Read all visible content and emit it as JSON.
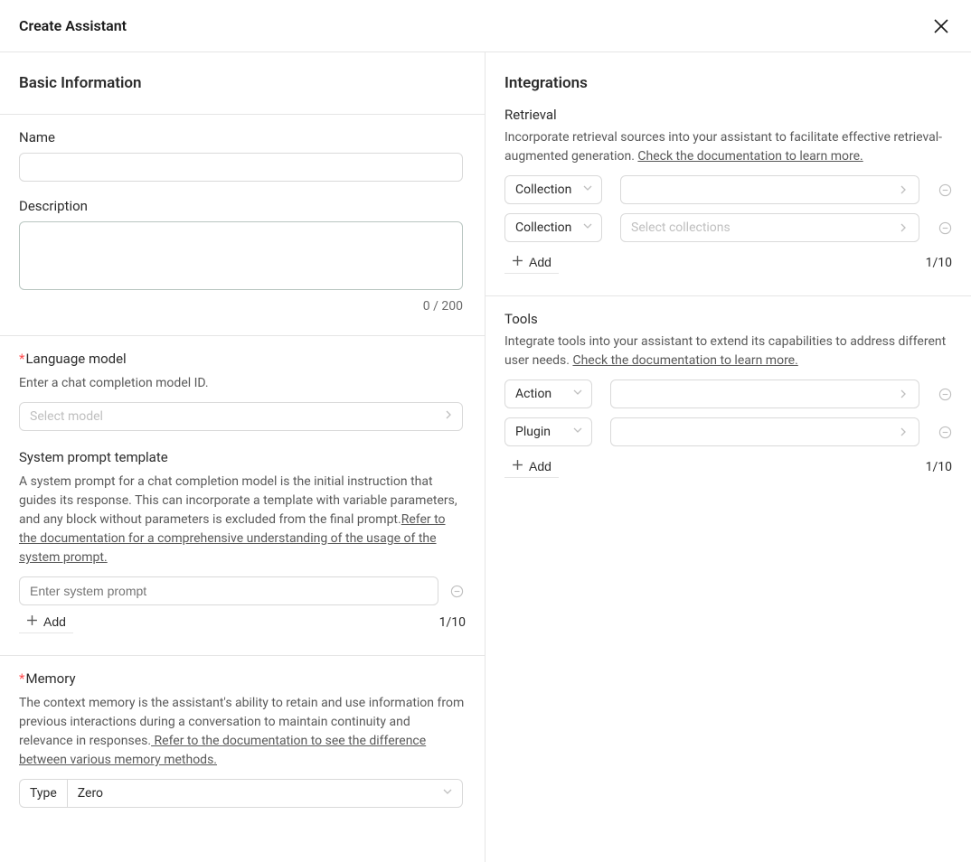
{
  "header": {
    "title": "Create Assistant"
  },
  "left": {
    "section_title": "Basic Information",
    "name": {
      "label": "Name",
      "value": ""
    },
    "description": {
      "label": "Description",
      "value": "",
      "char_count": "0 / 200"
    },
    "language_model": {
      "label": "Language model",
      "description": "Enter a chat completion model ID.",
      "placeholder": "Select model"
    },
    "system_prompt": {
      "label": "System prompt template",
      "description_before_link": "A system prompt for a chat completion model is the initial instruction that guides its response. This can incorporate a template with variable parameters, and any block without parameters is excluded from the final prompt.",
      "doc_link": "Refer to the documentation for a comprehensive understanding of the usage of the system prompt.",
      "placeholder": "Enter system prompt",
      "add_label": "Add",
      "counter": "1/10"
    },
    "memory": {
      "label": "Memory",
      "description_before_link": "The context memory is the assistant's ability to retain and use information from previous interactions during a conversation to maintain continuity and relevance in responses.",
      "doc_link": " Refer to the documentation to see the difference between various memory methods.",
      "type_label": "Type",
      "type_value": "Zero"
    }
  },
  "right": {
    "section_title": "Integrations",
    "retrieval": {
      "label": "Retrieval",
      "description": "Incorporate retrieval sources into your assistant to facilitate effective retrieval-augmented generation. ",
      "doc_link": "Check the documentation to learn more.",
      "rows": [
        {
          "type_label": "Collection",
          "placeholder": ""
        },
        {
          "type_label": "Collection",
          "placeholder": "Select collections"
        }
      ],
      "add_label": "Add",
      "counter": "1/10"
    },
    "tools": {
      "label": "Tools",
      "description": "Integrate tools into your assistant to extend its capabilities to address different user needs. ",
      "doc_link": "Check the documentation to learn more.",
      "rows": [
        {
          "type_label": "Action"
        },
        {
          "type_label": "Plugin"
        }
      ],
      "add_label": "Add",
      "counter": "1/10"
    }
  }
}
